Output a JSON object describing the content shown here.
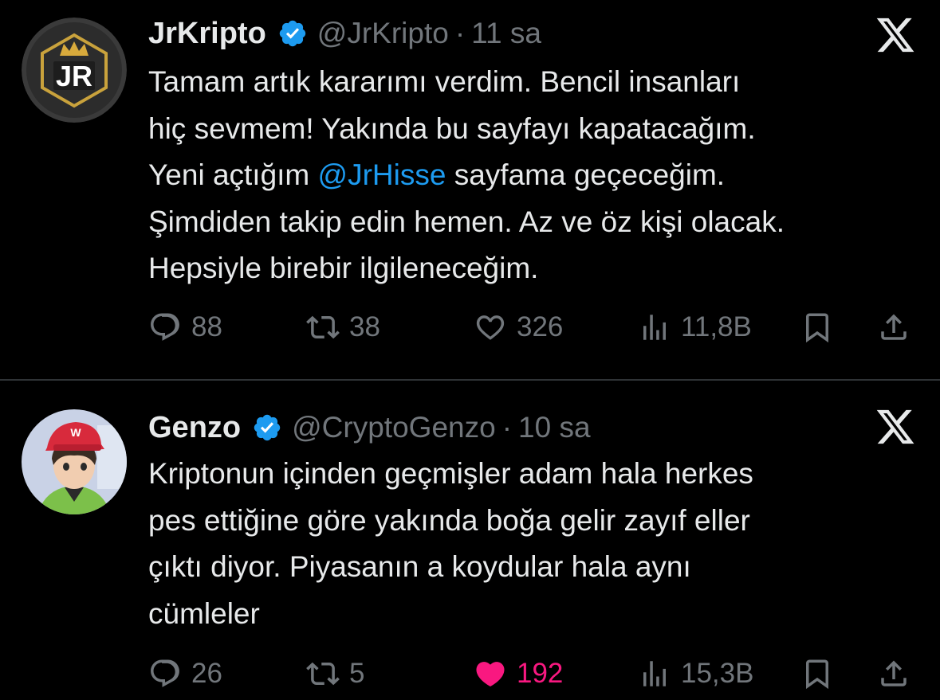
{
  "tweets": [
    {
      "name": "JrKripto",
      "handle": "@JrKripto",
      "separator": "·",
      "time": "11 sa",
      "text_lines": [
        "Tamam artık kararımı verdim. Bencil insanları",
        "hiç sevmem! Yakında bu sayfayı kapatacağım."
      ],
      "line3_before": "Yeni açtığım ",
      "line3_mention": "@JrHisse",
      "line3_after": " sayfama geçeceğim.",
      "text_lines_end": [
        "Şimdiden takip edin hemen. Az ve öz kişi olacak.",
        "Hepsiyle birebir ilgileneceğim."
      ],
      "replies": "88",
      "retweets": "38",
      "likes": "326",
      "views": "11,8B",
      "liked": false
    },
    {
      "name": "Genzo",
      "handle": "@CryptoGenzo",
      "separator": "·",
      "time": "10 sa",
      "text_lines": [
        "Kriptonun içinden geçmişler adam hala herkes",
        "pes ettiğine göre yakında boğa gelir zayıf eller",
        "çıktı diyor. Piyasanın a koydular hala aynı",
        "cümleler"
      ],
      "replies": "26",
      "retweets": "5",
      "likes": "192",
      "views": "15,3B",
      "liked": true
    }
  ],
  "colors": {
    "background": "#000000",
    "text": "#e7e9ea",
    "muted": "#71767b",
    "link": "#1d9bf0",
    "like_active": "#f91880",
    "verified": "#1d9bf0",
    "divider": "#2f3336"
  },
  "icons": [
    "verified-badge-icon",
    "x-logo-icon",
    "reply-icon",
    "retweet-icon",
    "like-icon",
    "views-icon",
    "bookmark-icon",
    "share-icon"
  ]
}
